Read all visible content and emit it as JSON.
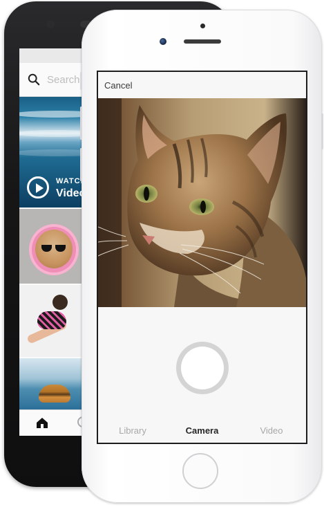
{
  "back_phone": {
    "search_placeholder": "Search",
    "video_tile": {
      "watch_label": "WATCH",
      "title": "Video"
    },
    "tabbar": {
      "home_icon": "home-icon",
      "search_icon": "search-icon"
    }
  },
  "front_phone": {
    "header": {
      "cancel_label": "Cancel"
    },
    "photo": {
      "subject": "cat portrait"
    },
    "modes": [
      {
        "label": "Library",
        "active": false
      },
      {
        "label": "Camera",
        "active": true
      },
      {
        "label": "Video",
        "active": false
      }
    ]
  },
  "colors": {
    "active_tab_text": "#262626",
    "inactive_tab_text": "#a8a8a8",
    "shutter_ring": "#d4d4d4"
  }
}
